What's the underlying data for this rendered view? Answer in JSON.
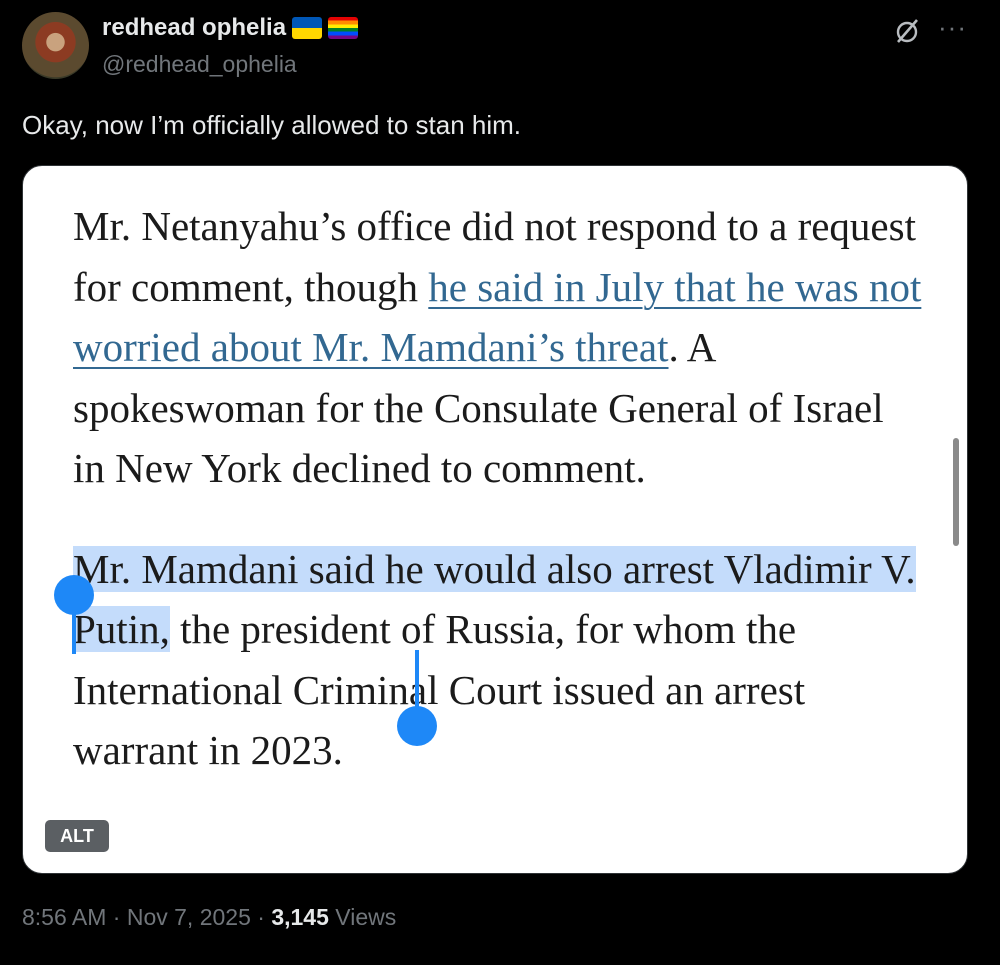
{
  "author": {
    "display_name": "redhead ophelia",
    "handle": "@redhead_ophelia",
    "flags": [
      "ukraine-flag",
      "rainbow-flag"
    ]
  },
  "tweet": {
    "text": "Okay, now I’m officially allowed to stan him."
  },
  "article": {
    "p1_before": "Mr. Netanyahu’s office did not respond to a request for comment, though ",
    "p1_link": "he said in July that he was not worried about Mr. Mamdani’s threat",
    "p1_after": ". A spokeswoman for the Consulate General of Israel in New York declined to comment.",
    "p2_selected": "Mr. Mamdani said he would also arrest Vladimir V. Putin,",
    "p2_rest": " the president of Russia, for whom the International Criminal Court issued an arrest warrant in 2023."
  },
  "media": {
    "alt_label": "ALT"
  },
  "meta": {
    "time": "8:56 AM",
    "separator": " · ",
    "date": "Nov 7, 2025",
    "views_count": "3,145",
    "views_label": " Views"
  },
  "colors": {
    "background": "#000000",
    "link": "#326891",
    "selection": "#c4dcfb",
    "selection_handle": "#1e88f7",
    "muted": "#71767b"
  },
  "icons": [
    "grok-icon",
    "more-icon"
  ]
}
